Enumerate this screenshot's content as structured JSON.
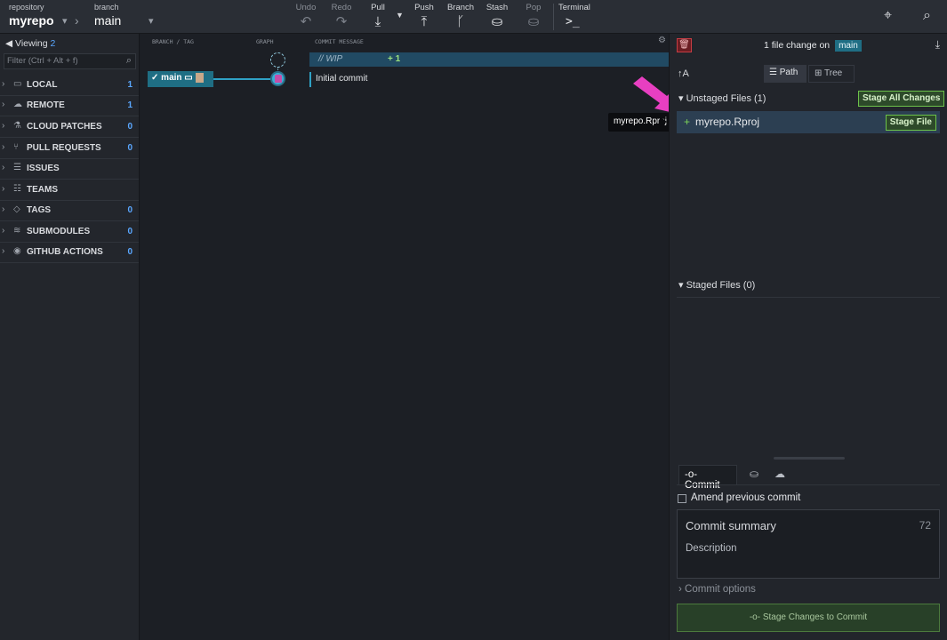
{
  "toolbar": {
    "repo_caption": "repository",
    "repo_name": "myrepo",
    "branch_caption": "branch",
    "branch_name": "main",
    "buttons": {
      "undo": "Undo",
      "redo": "Redo",
      "pull": "Pull",
      "push": "Push",
      "branch": "Branch",
      "stash": "Stash",
      "pop": "Pop",
      "terminal": "Terminal"
    }
  },
  "left": {
    "viewing_label": "Viewing",
    "viewing_count": "2",
    "filter_placeholder": "Filter (Ctrl + Alt + f)",
    "sections": [
      {
        "label": "LOCAL",
        "count": "1",
        "icon": "laptop-icon"
      },
      {
        "label": "REMOTE",
        "count": "1",
        "icon": "cloud-icon"
      },
      {
        "label": "CLOUD PATCHES",
        "count": "0",
        "icon": "flask-icon"
      },
      {
        "label": "PULL REQUESTS",
        "count": "0",
        "icon": "pull-request-icon"
      },
      {
        "label": "ISSUES",
        "count": "",
        "icon": "list-icon"
      },
      {
        "label": "TEAMS",
        "count": "",
        "icon": "team-icon"
      },
      {
        "label": "TAGS",
        "count": "0",
        "icon": "tag-icon"
      },
      {
        "label": "SUBMODULES",
        "count": "0",
        "icon": "stack-icon"
      },
      {
        "label": "GITHUB ACTIONS",
        "count": "0",
        "icon": "play-circle-icon"
      }
    ]
  },
  "graph": {
    "col_branch": "BRANCH / TAG",
    "col_graph": "GRAPH",
    "col_message": "COMMIT MESSAGE",
    "wip_label": "// WIP",
    "wip_changes": "+ 1",
    "branch_badge": "main",
    "commit_message": "Initial commit"
  },
  "tooltip": "myrepo.Rproj",
  "right": {
    "change_summary": "1 file change on",
    "change_branch": "main",
    "view_path": "Path",
    "view_tree": "Tree",
    "unstaged_header": "Unstaged Files (1)",
    "stage_all": "Stage All Changes",
    "file_name": "myrepo.Rproj",
    "stage_file": "Stage File",
    "staged_header": "Staged Files (0)",
    "commit_tab": "Commit",
    "amend_label": "Amend previous commit",
    "summary_placeholder": "Commit summary",
    "char_count": "72",
    "description_placeholder": "Description",
    "commit_options": "Commit options",
    "stage_to_commit": "Stage Changes to Commit"
  },
  "colors": {
    "accent_blue": "#1f6e84",
    "stage_green": "#6cc24a",
    "arrow_pink": "#e83fc1"
  }
}
